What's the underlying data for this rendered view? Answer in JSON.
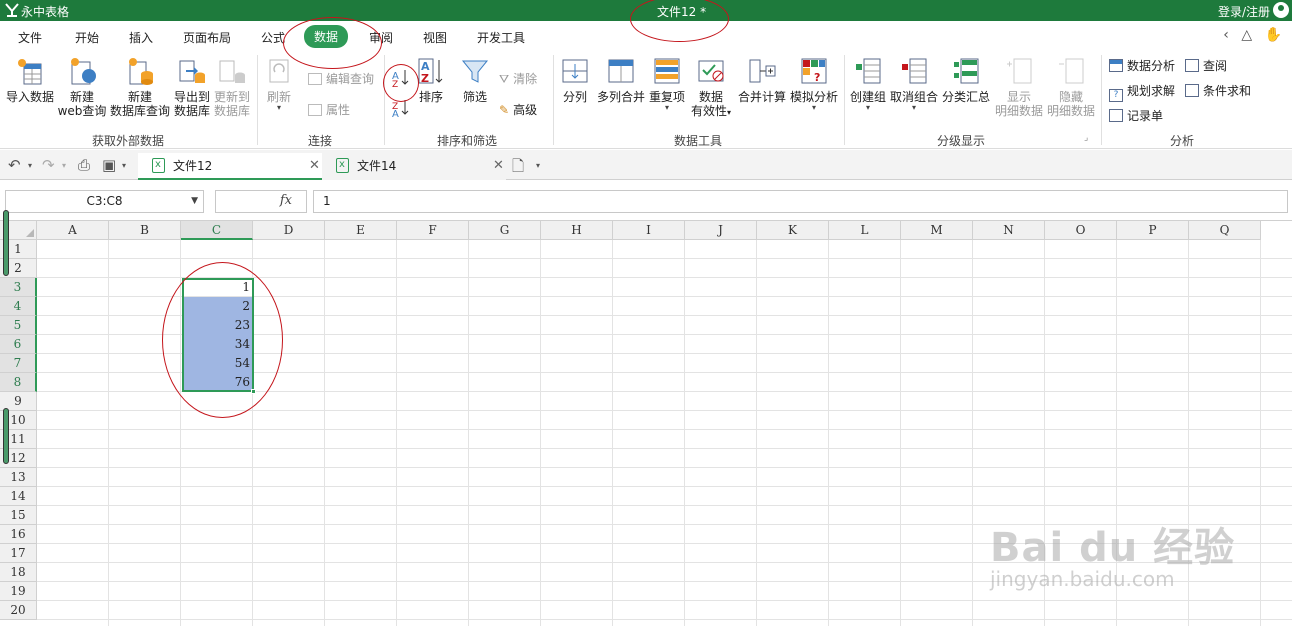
{
  "titlebar": {
    "app_name": "永中表格",
    "doc_title": "文件12 *",
    "login": "登录/注册"
  },
  "menu": {
    "tabs": [
      "文件",
      "开始",
      "插入",
      "页面布局",
      "公式",
      "数据",
      "审阅",
      "视图",
      "开发工具"
    ],
    "active_tab": "数据"
  },
  "ribbon": {
    "external": {
      "import_data": "导入数据",
      "new_web_1": "新建",
      "new_web_2": "web查询",
      "new_db_1": "新建",
      "new_db_2": "数据库查询",
      "export_db_1": "导出到",
      "export_db_2": "数据库",
      "update_db_1": "更新到",
      "update_db_2": "数据库",
      "label": "获取外部数据"
    },
    "connect": {
      "refresh": "刷新",
      "edit_query": "编辑查询",
      "properties": "属性",
      "label": "连接"
    },
    "sort_filter": {
      "sort": "排序",
      "filter": "筛选",
      "clear": "清除",
      "advanced": "高级",
      "label": "排序和筛选"
    },
    "data_tools": {
      "split": "分列",
      "merge_cols": "多列合并",
      "duplicates": "重复项",
      "validity_1": "数据",
      "validity_2": "有效性",
      "consolidate": "合并计算",
      "what_if": "模拟分析",
      "label": "数据工具"
    },
    "outline": {
      "group": "创建组",
      "ungroup": "取消组合",
      "subtotal": "分类汇总",
      "show_1": "显示",
      "show_2": "明细数据",
      "hide_1": "隐藏",
      "hide_2": "明细数据",
      "label": "分级显示"
    },
    "analysis": {
      "data_analysis": "数据分析",
      "query": "查阅",
      "solver": "规划求解",
      "cond_sum": "条件求和",
      "record": "记录单",
      "label": "分析"
    }
  },
  "doc_tabs": [
    "文件12",
    "文件14"
  ],
  "formula_bar": {
    "name_box": "C3:C8",
    "fx": "fx",
    "value": "1"
  },
  "grid": {
    "columns": [
      "A",
      "B",
      "C",
      "D",
      "E",
      "F",
      "G",
      "H",
      "I",
      "J",
      "K",
      "L",
      "M",
      "N",
      "O",
      "P",
      "Q"
    ],
    "selected_column": "C",
    "rows": [
      "1",
      "2",
      "3",
      "4",
      "5",
      "6",
      "7",
      "8",
      "9",
      "10",
      "11",
      "12",
      "13",
      "14",
      "15",
      "16",
      "17",
      "18",
      "19",
      "20"
    ],
    "selected_rows": [
      "3",
      "4",
      "5",
      "6",
      "7",
      "8"
    ],
    "column_c_values": [
      "1",
      "2",
      "23",
      "34",
      "54",
      "76"
    ]
  },
  "watermark": {
    "brand": "Bai du 经验",
    "url": "jingyan.baidu.com"
  },
  "colors": {
    "accent": "#2e9a57",
    "titlebar": "#1e7a3c",
    "selection_fill": "#9fb6e2",
    "annotation": "#c4161c"
  }
}
